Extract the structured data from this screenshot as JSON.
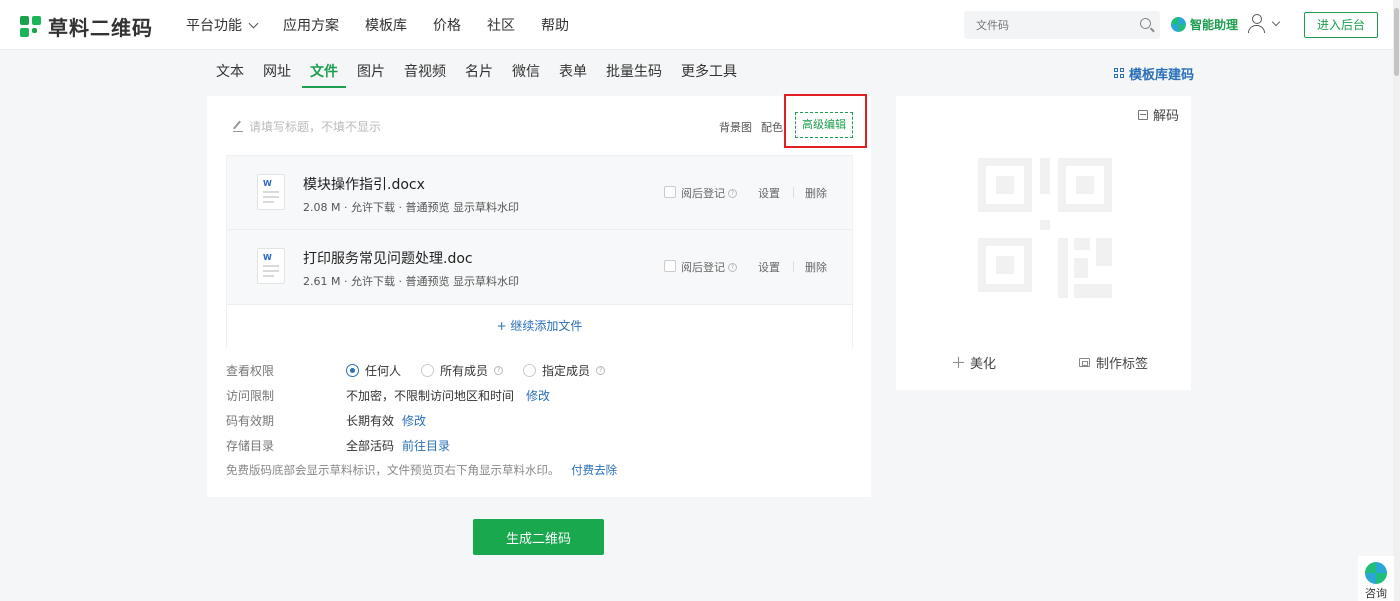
{
  "header": {
    "brand": "草料二维码",
    "nav": [
      {
        "label": "平台功能",
        "has_dropdown": true
      },
      {
        "label": "应用方案"
      },
      {
        "label": "模板库"
      },
      {
        "label": "价格"
      },
      {
        "label": "社区"
      },
      {
        "label": "帮助"
      }
    ],
    "search_placeholder": "文件码",
    "assistant_label": "智能助理",
    "enter_label": "进入后台"
  },
  "tabs": [
    "文本",
    "网址",
    "文件",
    "图片",
    "音视频",
    "名片",
    "微信",
    "表单",
    "批量生码",
    "更多工具"
  ],
  "active_tab": "文件",
  "template_link": "模板库建码",
  "editor": {
    "title_placeholder": "请填写标题，不填不显示",
    "bg_label": "背景图",
    "color_label": "配色",
    "advanced_label": "高级编辑",
    "files": [
      {
        "name": "模块操作指引.docx",
        "meta": "2.08 M · 允许下载 · 普通预览 显示草料水印",
        "checkbox_label": "阅后登记",
        "settings_label": "设置",
        "delete_label": "删除"
      },
      {
        "name": "打印服务常见问题处理.doc",
        "meta": "2.61 M · 允许下载 · 普通预览 显示草料水印",
        "checkbox_label": "阅后登记",
        "settings_label": "设置",
        "delete_label": "删除"
      }
    ],
    "add_file_label": "+ 继续添加文件",
    "permission": {
      "label": "查看权限",
      "options": [
        "任何人",
        "所有成员",
        "指定成员"
      ],
      "selected": "任何人"
    },
    "access": {
      "label": "访问限制",
      "value": "不加密，不限制访问地区和时间",
      "action": "修改"
    },
    "validity": {
      "label": "码有效期",
      "value": "长期有效",
      "action": "修改"
    },
    "storage": {
      "label": "存储目录",
      "value": "全部活码",
      "action": "前往目录"
    },
    "note": "免费版码底部会显示草料标识，文件预览页右下角显示草料水印。",
    "note_action": "付费去除"
  },
  "generate_label": "生成二维码",
  "preview": {
    "decode_label": "解码",
    "beautify_label": "美化",
    "make_label": "制作标签"
  },
  "consult_label": "咨询",
  "colors": {
    "brand_green": "#1e9e4f",
    "link_blue": "#2a6fb8",
    "highlight_red": "#e02020"
  }
}
